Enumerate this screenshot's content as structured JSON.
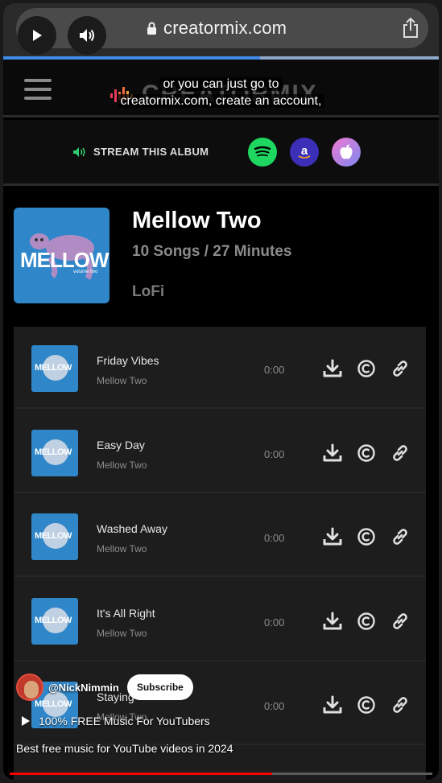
{
  "browser": {
    "url": "creatormix.com",
    "play_icon": "play-icon",
    "volume_icon": "volume-icon",
    "lock_icon": "lock-icon",
    "share_icon": "share-icon",
    "load_progress": 0.59
  },
  "site": {
    "logo_text": "CREATORMIX",
    "menu_icon": "hamburger-icon"
  },
  "caption": {
    "line1": "or you can just go to",
    "line2": "creatormix.com, create an account,"
  },
  "stream": {
    "label": "STREAM THIS ALBUM",
    "services": [
      "spotify",
      "amazon",
      "apple"
    ],
    "colors": {
      "spotify": "#1ed760",
      "amazon": "#3b2fb8",
      "apple": "#d36fd0"
    }
  },
  "album": {
    "cover_text": "MELLOW",
    "cover_sub": "volume two",
    "title": "Mellow Two",
    "meta": "10 Songs / 27 Minutes",
    "genre": "LoFi"
  },
  "tracks": [
    {
      "title": "Friday Vibes",
      "artist": "Mellow Two",
      "time": "0:00",
      "thumb": "MELLOW"
    },
    {
      "title": "Easy Day",
      "artist": "Mellow Two",
      "time": "0:00",
      "thumb": "MELLOW"
    },
    {
      "title": "Washed Away",
      "artist": "Mellow Two",
      "time": "0:00",
      "thumb": "MELLOW"
    },
    {
      "title": "It's All Right",
      "artist": "Mellow Two",
      "time": "0:00",
      "thumb": "MELLOW"
    },
    {
      "title": "Staying",
      "artist": "Mellow Two",
      "time": "0:00",
      "thumb": "MELLOW"
    }
  ],
  "youtube": {
    "channel": "@NickNimmin",
    "subscribe": "Subscribe",
    "playlist": "100% FREE Music For YouTubers",
    "description": "Best free music for YouTube videos in 2024",
    "progress": 0.62,
    "accent": "#ff0000"
  }
}
